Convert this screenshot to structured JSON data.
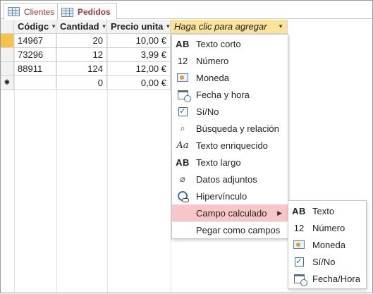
{
  "tabs": [
    {
      "label": "Clientes",
      "active": false
    },
    {
      "label": "Pedidos",
      "active": true
    }
  ],
  "table": {
    "columns": [
      "Códigc",
      "Cantidad",
      "Precio unita",
      "Haga clic para agregar"
    ],
    "rows": [
      [
        "14967",
        "20",
        "10,00 €"
      ],
      [
        "73296",
        "12",
        "3,99 €"
      ],
      [
        "88911",
        "124",
        "12,00 €"
      ],
      [
        "",
        "0",
        "0,00 €"
      ]
    ],
    "new_row_marker": "✱"
  },
  "menu": {
    "items": [
      {
        "icon": "AB",
        "icon_name": "short-text-icon",
        "label": "Texto corto"
      },
      {
        "icon": "12",
        "icon_name": "number-icon",
        "label": "Número"
      },
      {
        "icon": "",
        "icon_name": "currency-icon",
        "label": "Moneda"
      },
      {
        "icon": "",
        "icon_name": "calendar-icon",
        "label": "Fecha y hora"
      },
      {
        "icon": "✓",
        "icon_name": "checkbox-icon",
        "label": "Sí/No"
      },
      {
        "icon": "⌕",
        "icon_name": "lookup-icon",
        "label": "Búsqueda y relación"
      },
      {
        "icon": "Aa",
        "icon_name": "rich-text-icon",
        "label": "Texto enriquecido"
      },
      {
        "icon": "AB",
        "icon_name": "long-text-icon",
        "label": "Texto largo"
      },
      {
        "icon": "⌀",
        "icon_name": "attachment-icon",
        "label": "Datos adjuntos"
      },
      {
        "icon": "",
        "icon_name": "hyperlink-icon",
        "label": "Hipervínculo"
      },
      {
        "icon": "",
        "icon_name": "calculated-icon",
        "label": "Campo calculado",
        "submenu_arrow": "▶"
      },
      {
        "icon": "",
        "icon_name": "paste-icon",
        "label": "Pegar como campos"
      }
    ]
  },
  "submenu": {
    "items": [
      {
        "icon": "AB",
        "icon_name": "text-icon",
        "label": "Texto"
      },
      {
        "icon": "12",
        "icon_name": "number-icon",
        "label": "Número"
      },
      {
        "icon": "",
        "icon_name": "currency-icon",
        "label": "Moneda"
      },
      {
        "icon": "✓",
        "icon_name": "checkbox-icon",
        "label": "Sí/No"
      },
      {
        "icon": "",
        "icon_name": "calendar-icon",
        "label": "Fecha/Hora"
      }
    ]
  },
  "colors": {
    "tab_text": "#a4373a",
    "add_column_bg": "#fbe39a",
    "current_row_selector": "#f5c34a",
    "menu_highlight": "#f6c6c9"
  }
}
